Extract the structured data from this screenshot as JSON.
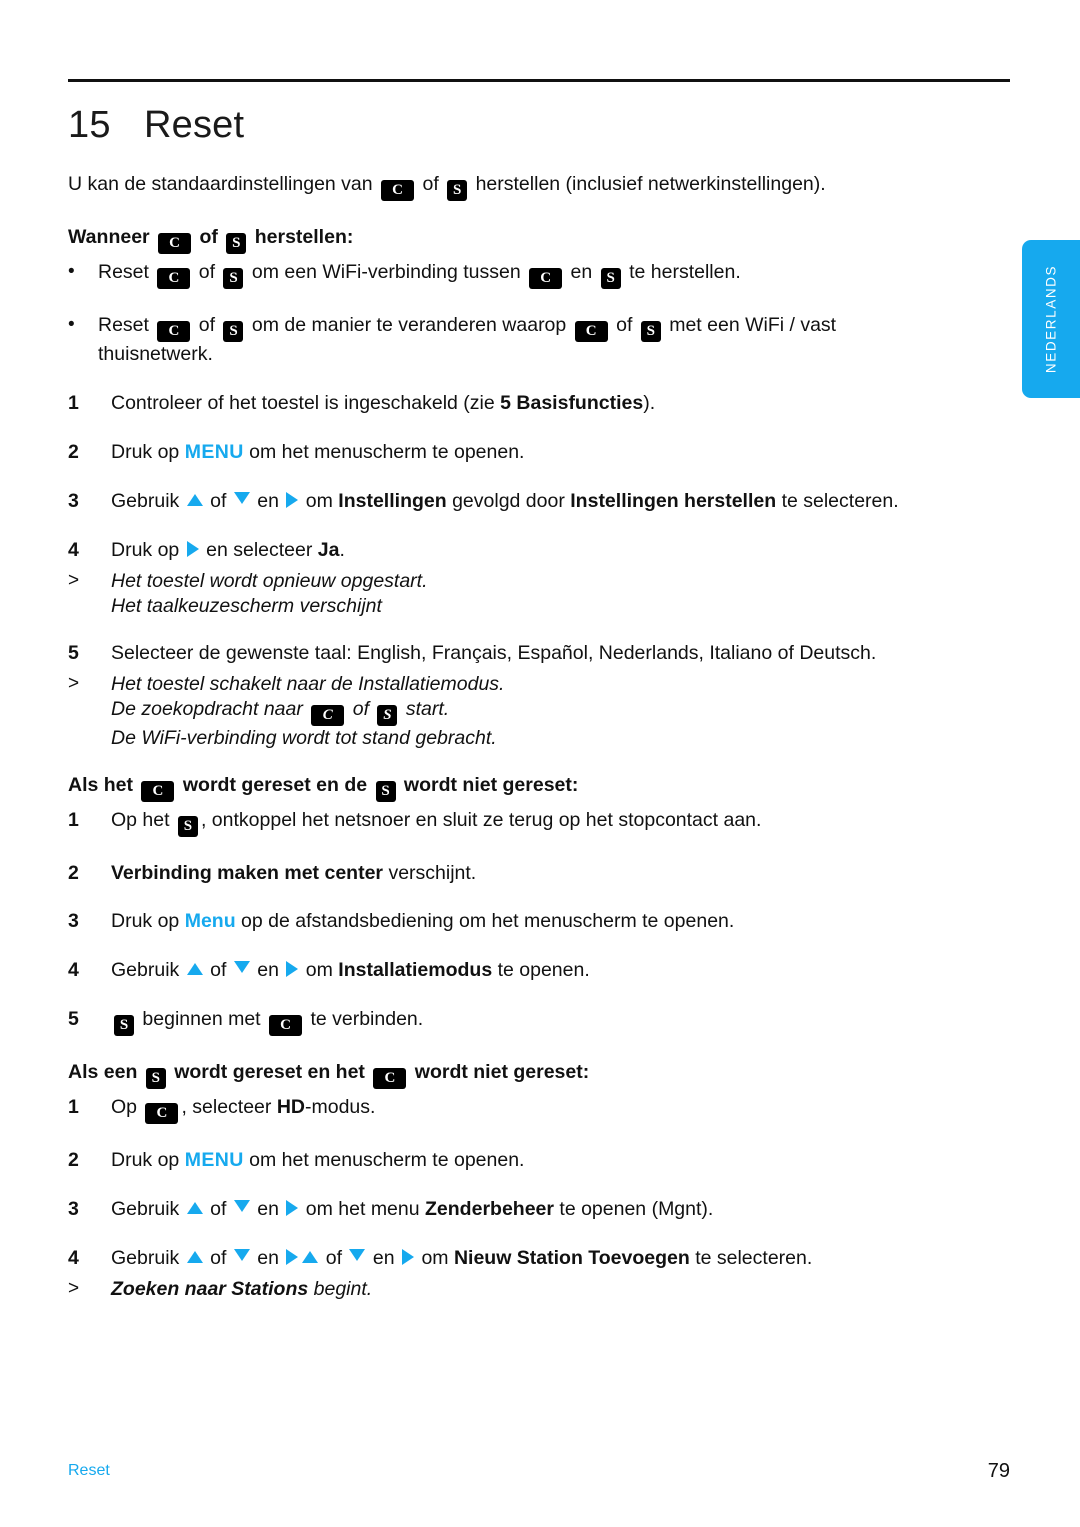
{
  "chapter": {
    "number": "15",
    "title": "Reset"
  },
  "side_tab": {
    "label": "NEDERLANDS"
  },
  "colors": {
    "accent_blue": "#16a9ee",
    "text_black": "#111111"
  },
  "icons": {
    "center": "C",
    "station": "S"
  },
  "intro": {
    "part1": "U kan de standaardinstellingen van",
    "part2": "of",
    "part3": "herstellen (inclusief netwerkinstellingen)."
  },
  "section1": {
    "heading": {
      "part1": "Wanneer",
      "part2": "of",
      "part3": "herstellen:"
    },
    "bullets": [
      {
        "marker": "•",
        "part1": "Reset",
        "part2": "of",
        "part3": "om een WiFi-verbinding tussen",
        "part4": "en",
        "part5": "te herstellen."
      },
      {
        "marker": "•",
        "part1": "Reset",
        "part2": "of",
        "part3": "om de manier te veranderen waarop",
        "part4": "of",
        "part5": "met een WiFi / vast",
        "part6": "thuisnetwerk."
      }
    ],
    "steps": [
      {
        "num": "1",
        "part1": "Controleer of het toestel is ingeschakeld (zie",
        "bold1": "5 Basisfuncties",
        "part2": ")."
      },
      {
        "num": "2",
        "part1": "Druk op",
        "blue1": "MENU",
        "part2": "om het menuscherm te openen."
      },
      {
        "num": "3",
        "part1": "Gebruik",
        "part2": "of",
        "part3": "en",
        "part4": "om",
        "bold1": "Instellingen",
        "part5": "gevolgd door",
        "bold2": "Instellingen herstellen",
        "part6": "te selecteren."
      },
      {
        "num": "4",
        "part1": "Druk op",
        "part2": "en selecteer",
        "bold1": "Ja",
        "part3": "."
      }
    ],
    "notes_after_4": {
      "marker": ">",
      "line1": "Het toestel wordt opnieuw opgestart.",
      "line2": "Het taalkeuzescherm verschijnt"
    },
    "step5": {
      "num": "5",
      "text": "Selecteer de gewenste taal: English, Français, Español, Nederlands, Italiano of Deutsch."
    },
    "notes_after_5": {
      "marker": ">",
      "line1": "Het toestel schakelt naar de Installatiemodus.",
      "line2_part1": "De zoekopdracht naar",
      "line2_part2": "of",
      "line2_part3": "start.",
      "line3": "De WiFi-verbinding wordt tot stand gebracht."
    }
  },
  "section2": {
    "heading": {
      "part1": "Als het",
      "part2": "wordt gereset en de",
      "part3": "wordt niet gereset:"
    },
    "steps": [
      {
        "num": "1",
        "part1": "Op het",
        "part2": ", ontkoppel het netsnoer en sluit ze terug op het stopcontact aan."
      },
      {
        "num": "2",
        "bold1": "Verbinding maken met center",
        "part1": "verschijnt."
      },
      {
        "num": "3",
        "part1": "Druk op",
        "blue1": "Menu",
        "part2": "op de afstandsbediening om het menuscherm te openen."
      },
      {
        "num": "4",
        "part1": "Gebruik",
        "part2": "of",
        "part3": "en",
        "part4": "om",
        "bold1": "Installatiemodus",
        "part5": "te openen."
      },
      {
        "num": "5",
        "part1": "beginnen met",
        "part2": "te verbinden."
      }
    ]
  },
  "section3": {
    "heading": {
      "part1": "Als een",
      "part2": "wordt gereset en het",
      "part3": "wordt niet gereset:"
    },
    "steps": [
      {
        "num": "1",
        "part1": "Op",
        "part2": ", selecteer",
        "bold1": "HD",
        "part3": "-modus."
      },
      {
        "num": "2",
        "part1": "Druk op",
        "blue1": "MENU",
        "part2": "om het menuscherm te openen."
      },
      {
        "num": "3",
        "part1": "Gebruik",
        "part2": "of",
        "part3": "en",
        "part4": "om het menu",
        "bold1": "Zenderbeheer",
        "part5": "te openen (Mgnt)."
      },
      {
        "num": "4",
        "part1": "Gebruik",
        "part2": "of",
        "part3": "en",
        "part4": "of",
        "part5": "en",
        "part6": "om",
        "bold1": "Nieuw Station Toevoegen",
        "part7": "te selecteren."
      }
    ],
    "note": {
      "marker": ">",
      "bold1": "Zoeken naar Stations",
      "part1": "begint."
    }
  },
  "footer": {
    "left": "Reset",
    "page_number": "79"
  }
}
